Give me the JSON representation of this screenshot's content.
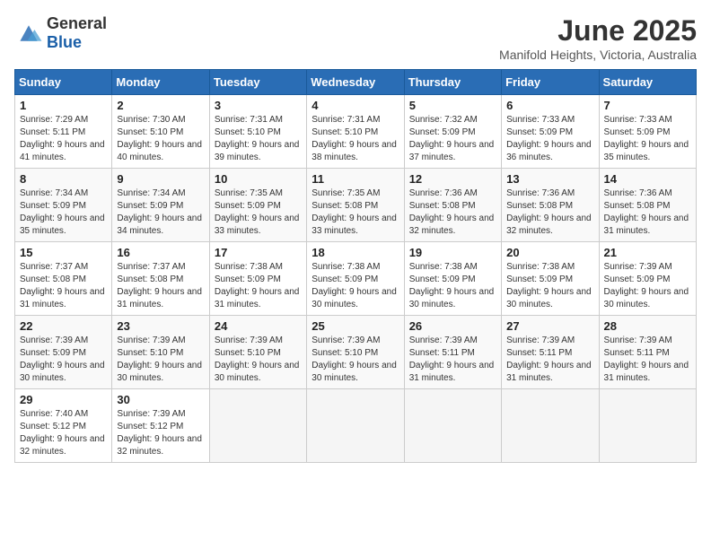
{
  "header": {
    "logo_general": "General",
    "logo_blue": "Blue",
    "title": "June 2025",
    "subtitle": "Manifold Heights, Victoria, Australia"
  },
  "calendar": {
    "days_of_week": [
      "Sunday",
      "Monday",
      "Tuesday",
      "Wednesday",
      "Thursday",
      "Friday",
      "Saturday"
    ],
    "weeks": [
      [
        {
          "day": 1,
          "sunrise": "7:29 AM",
          "sunset": "5:11 PM",
          "daylight": "9 hours and 41 minutes."
        },
        {
          "day": 2,
          "sunrise": "7:30 AM",
          "sunset": "5:10 PM",
          "daylight": "9 hours and 40 minutes."
        },
        {
          "day": 3,
          "sunrise": "7:31 AM",
          "sunset": "5:10 PM",
          "daylight": "9 hours and 39 minutes."
        },
        {
          "day": 4,
          "sunrise": "7:31 AM",
          "sunset": "5:10 PM",
          "daylight": "9 hours and 38 minutes."
        },
        {
          "day": 5,
          "sunrise": "7:32 AM",
          "sunset": "5:09 PM",
          "daylight": "9 hours and 37 minutes."
        },
        {
          "day": 6,
          "sunrise": "7:33 AM",
          "sunset": "5:09 PM",
          "daylight": "9 hours and 36 minutes."
        },
        {
          "day": 7,
          "sunrise": "7:33 AM",
          "sunset": "5:09 PM",
          "daylight": "9 hours and 35 minutes."
        }
      ],
      [
        {
          "day": 8,
          "sunrise": "7:34 AM",
          "sunset": "5:09 PM",
          "daylight": "9 hours and 35 minutes."
        },
        {
          "day": 9,
          "sunrise": "7:34 AM",
          "sunset": "5:09 PM",
          "daylight": "9 hours and 34 minutes."
        },
        {
          "day": 10,
          "sunrise": "7:35 AM",
          "sunset": "5:09 PM",
          "daylight": "9 hours and 33 minutes."
        },
        {
          "day": 11,
          "sunrise": "7:35 AM",
          "sunset": "5:08 PM",
          "daylight": "9 hours and 33 minutes."
        },
        {
          "day": 12,
          "sunrise": "7:36 AM",
          "sunset": "5:08 PM",
          "daylight": "9 hours and 32 minutes."
        },
        {
          "day": 13,
          "sunrise": "7:36 AM",
          "sunset": "5:08 PM",
          "daylight": "9 hours and 32 minutes."
        },
        {
          "day": 14,
          "sunrise": "7:36 AM",
          "sunset": "5:08 PM",
          "daylight": "9 hours and 31 minutes."
        }
      ],
      [
        {
          "day": 15,
          "sunrise": "7:37 AM",
          "sunset": "5:08 PM",
          "daylight": "9 hours and 31 minutes."
        },
        {
          "day": 16,
          "sunrise": "7:37 AM",
          "sunset": "5:08 PM",
          "daylight": "9 hours and 31 minutes."
        },
        {
          "day": 17,
          "sunrise": "7:38 AM",
          "sunset": "5:09 PM",
          "daylight": "9 hours and 31 minutes."
        },
        {
          "day": 18,
          "sunrise": "7:38 AM",
          "sunset": "5:09 PM",
          "daylight": "9 hours and 30 minutes."
        },
        {
          "day": 19,
          "sunrise": "7:38 AM",
          "sunset": "5:09 PM",
          "daylight": "9 hours and 30 minutes."
        },
        {
          "day": 20,
          "sunrise": "7:38 AM",
          "sunset": "5:09 PM",
          "daylight": "9 hours and 30 minutes."
        },
        {
          "day": 21,
          "sunrise": "7:39 AM",
          "sunset": "5:09 PM",
          "daylight": "9 hours and 30 minutes."
        }
      ],
      [
        {
          "day": 22,
          "sunrise": "7:39 AM",
          "sunset": "5:09 PM",
          "daylight": "9 hours and 30 minutes."
        },
        {
          "day": 23,
          "sunrise": "7:39 AM",
          "sunset": "5:10 PM",
          "daylight": "9 hours and 30 minutes."
        },
        {
          "day": 24,
          "sunrise": "7:39 AM",
          "sunset": "5:10 PM",
          "daylight": "9 hours and 30 minutes."
        },
        {
          "day": 25,
          "sunrise": "7:39 AM",
          "sunset": "5:10 PM",
          "daylight": "9 hours and 30 minutes."
        },
        {
          "day": 26,
          "sunrise": "7:39 AM",
          "sunset": "5:11 PM",
          "daylight": "9 hours and 31 minutes."
        },
        {
          "day": 27,
          "sunrise": "7:39 AM",
          "sunset": "5:11 PM",
          "daylight": "9 hours and 31 minutes."
        },
        {
          "day": 28,
          "sunrise": "7:39 AM",
          "sunset": "5:11 PM",
          "daylight": "9 hours and 31 minutes."
        }
      ],
      [
        {
          "day": 29,
          "sunrise": "7:40 AM",
          "sunset": "5:12 PM",
          "daylight": "9 hours and 32 minutes."
        },
        {
          "day": 30,
          "sunrise": "7:39 AM",
          "sunset": "5:12 PM",
          "daylight": "9 hours and 32 minutes."
        },
        null,
        null,
        null,
        null,
        null
      ]
    ]
  }
}
